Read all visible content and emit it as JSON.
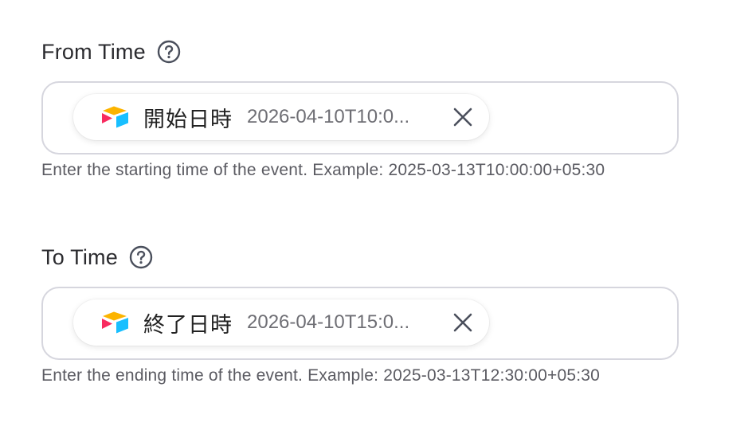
{
  "from_time": {
    "label": "From Time",
    "chip": {
      "icon": "airtable-logo-icon",
      "name": "開始日時",
      "value": "2026-04-10T10:0..."
    },
    "hint": "Enter the starting time of the event. Example: 2025-03-13T10:00:00+05:30"
  },
  "to_time": {
    "label": "To Time",
    "chip": {
      "icon": "airtable-logo-icon",
      "name": "終了日時",
      "value": "2026-04-10T15:0..."
    },
    "hint": "Enter the ending time of the event. Example: 2025-03-13T12:30:00+05:30"
  },
  "colors": {
    "border": "#d6d6de",
    "label": "#2b2b2f",
    "hint": "#5b5b62",
    "logo_yellow": "#fcb400",
    "logo_red": "#f82b60",
    "logo_blue": "#18bfff"
  }
}
